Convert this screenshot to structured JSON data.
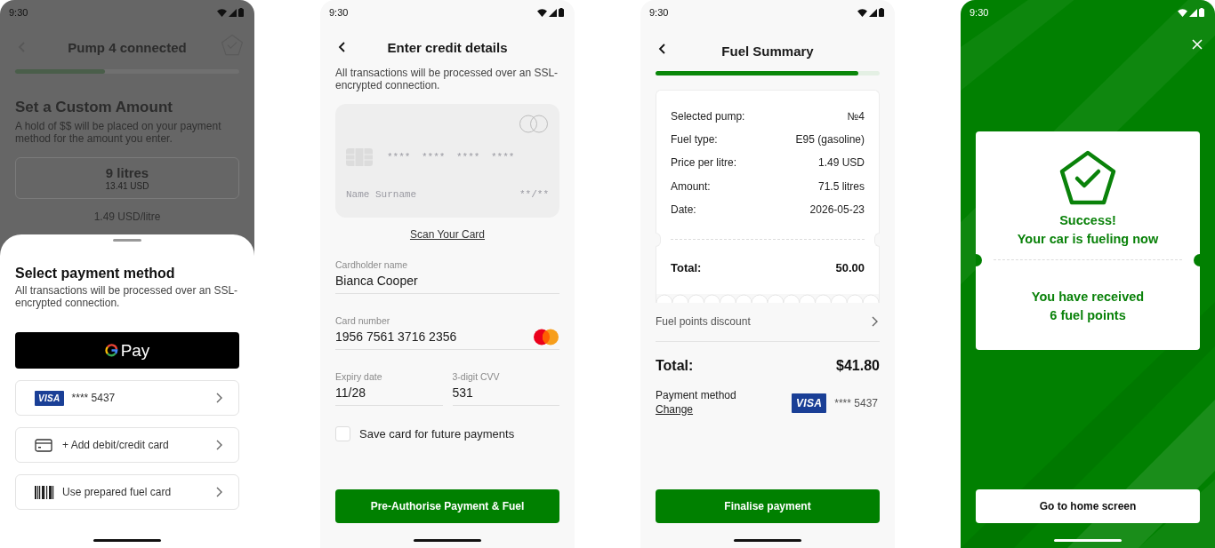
{
  "pump_screen": {
    "status_time": "9:30",
    "title": "Pump 4 connected",
    "progress": {
      "level": 0.4
    },
    "heading": "Set a Custom Amount",
    "description": "A hold of $$ will be placed on your payment method for the amount you enter.",
    "amount": "9 litres",
    "amount_price": "13.41 USD",
    "unit_price": "1.49 USD/litre"
  },
  "payment_sheet": {
    "title": "Select payment method",
    "description": "All transactions will be processed over an SSL-encrypted connection.",
    "gpay_label": "Pay",
    "options": [
      {
        "kind": "saved-card",
        "brand": "VISA",
        "label": "**** 5437"
      },
      {
        "kind": "add-card",
        "label": "+ Add debit/credit card"
      },
      {
        "kind": "fuel-card",
        "label": "Use prepared fuel card"
      }
    ]
  },
  "credit_screen": {
    "status_time": "9:30",
    "title": "Enter credit details",
    "description": "All transactions will be processed over an SSL-encrypted connection.",
    "card_preview": {
      "number": "**** **** **** ****",
      "name": "Name Surname",
      "expiry": "**/**"
    },
    "scan_link": "Scan Your Card",
    "fields": [
      {
        "kind": "full",
        "label": "Cardholder name",
        "value": "Bianca Cooper"
      },
      {
        "kind": "card",
        "label": "Card number",
        "value": "1956 7561 3716 2356"
      },
      {
        "kind": "half",
        "label": "Expiry date",
        "value": "11/28"
      },
      {
        "kind": "half",
        "label": "3-digit CVV",
        "value": "531"
      }
    ],
    "save_card": {
      "label": "Save card for future payments",
      "checked": false
    },
    "button": "Pre-Authorise Payment & Fuel"
  },
  "summary_screen": {
    "status_time": "9:30",
    "title": "Fuel Summary",
    "progress": {
      "level": 0.905
    },
    "receipt": {
      "rows": [
        {
          "label": "Selected pump:",
          "value": "№4"
        },
        {
          "label": "Fuel type:",
          "value": "E95 (gasoline)"
        },
        {
          "label": "Price per litre:",
          "value": "1.49 USD"
        },
        {
          "label": "Amount:",
          "value": "71.5 litres"
        },
        {
          "label": "Date:",
          "value": "2026-05-23"
        }
      ],
      "total_label": "Total:",
      "total_value": "50.00"
    },
    "discount": "Fuel points discount",
    "total_label": "Total:",
    "total_value": "$41.80",
    "payment_label": "Payment method",
    "change_link": "Change",
    "card_brand": "VISA",
    "card_number": "**** 5437",
    "button": "Finalise payment"
  },
  "success_screen": {
    "status_time": "9:30",
    "title_lines": [
      "Success!",
      "Your car is fueling now"
    ],
    "points_lines": [
      "You have received",
      "6 fuel points"
    ],
    "button": "Go to home screen"
  }
}
